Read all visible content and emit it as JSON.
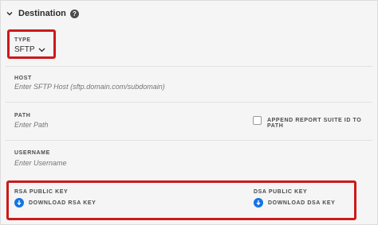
{
  "section": {
    "title": "Destination",
    "help_symbol": "?"
  },
  "type_field": {
    "label": "TYPE",
    "selected": "SFTP"
  },
  "host_field": {
    "label": "HOST",
    "placeholder": "Enter SFTP Host (sftp.domain.com/subdomain)"
  },
  "path_field": {
    "label": "PATH",
    "placeholder": "Enter Path"
  },
  "append_option": {
    "label": "APPEND REPORT SUITE ID TO PATH",
    "checked": false
  },
  "username_field": {
    "label": "USERNAME",
    "placeholder": "Enter Username"
  },
  "rsa_key": {
    "label": "RSA PUBLIC KEY",
    "action": "DOWNLOAD RSA KEY"
  },
  "dsa_key": {
    "label": "DSA PUBLIC KEY",
    "action": "DOWNLOAD DSA KEY"
  },
  "icons": {
    "collapse": "chevron-down-icon",
    "help": "help-icon",
    "download": "download-icon"
  },
  "colors": {
    "highlight": "#cc1a1a",
    "download_icon": "#1473e6"
  }
}
